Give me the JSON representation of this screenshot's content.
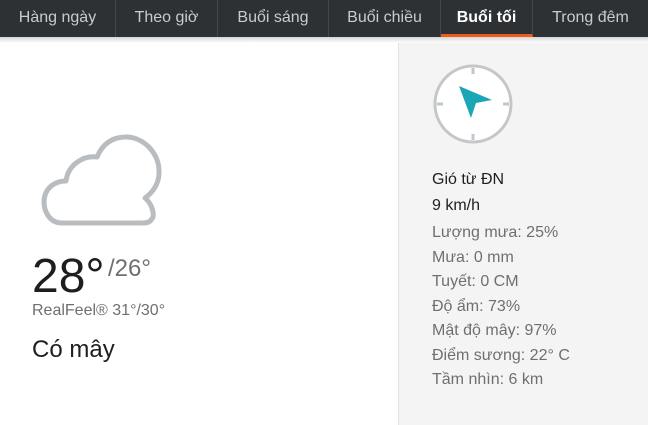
{
  "tabs": [
    {
      "label": "Hàng ngày"
    },
    {
      "label": "Theo giờ"
    },
    {
      "label": "Buổi sáng"
    },
    {
      "label": "Buổi chiều"
    },
    {
      "label": "Buổi tối"
    },
    {
      "label": "Trong đêm"
    }
  ],
  "active_tab": "Buổi tối",
  "current": {
    "weather_icon": "cloud-icon",
    "temp": "28°",
    "temp_low": "/26°",
    "realfeel": "RealFeel® 31°/30°",
    "phrase": "Có mây"
  },
  "wind": {
    "compass_icon": "compass-icon",
    "direction": "Gió từ ĐN",
    "speed": "9 km/h"
  },
  "stats": [
    "Lượng mưa: 25%",
    "Mưa: 0 mm",
    "Tuyết: 0 CM",
    "Độ ẩm: 73%",
    "Mật độ mây: 97%",
    "Điểm sương: 22° C",
    "Tầm nhìn: 6 km"
  ],
  "colors": {
    "tab_bar": "#2e3134",
    "active_underline": "#f05a1e",
    "compass_arrow": "#1aa6b7",
    "right_panel": "#f4f4f4"
  }
}
